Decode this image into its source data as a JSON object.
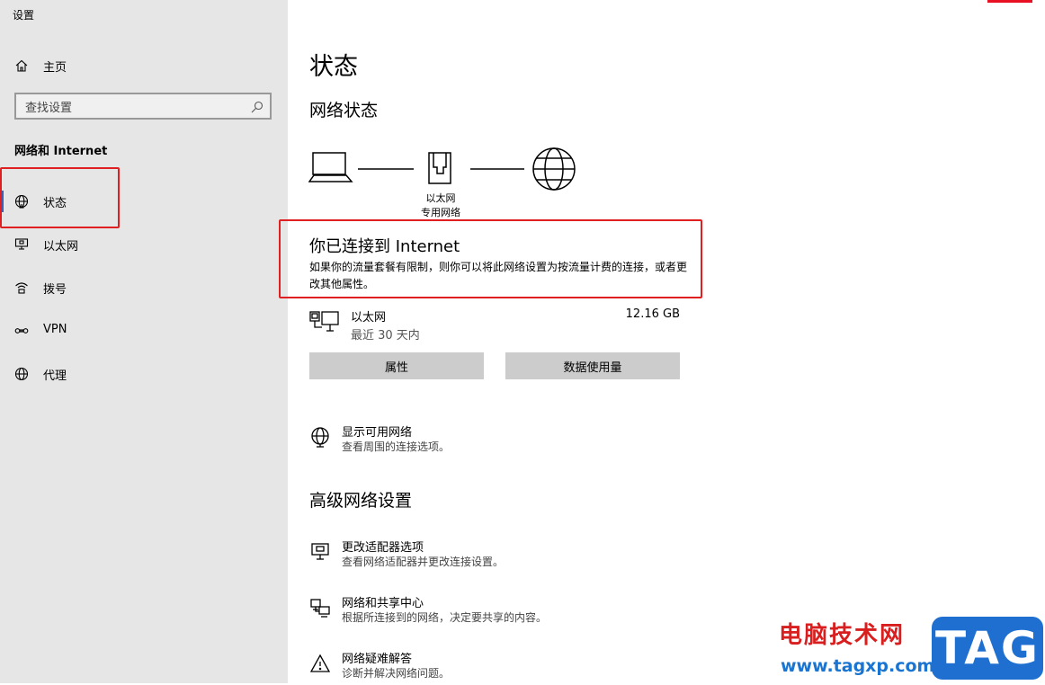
{
  "window": {
    "title": "设置"
  },
  "sidebar": {
    "home_label": "主页",
    "search_placeholder": "查找设置",
    "section_title": "网络和 Internet",
    "items": [
      {
        "label": "状态",
        "icon": "globe-status-icon",
        "active": true
      },
      {
        "label": "以太网",
        "icon": "ethernet-icon",
        "active": false
      },
      {
        "label": "拨号",
        "icon": "dialup-icon",
        "active": false
      },
      {
        "label": "VPN",
        "icon": "vpn-icon",
        "active": false
      },
      {
        "label": "代理",
        "icon": "globe-icon",
        "active": false
      }
    ]
  },
  "main": {
    "page_title": "状态",
    "network_status_heading": "网络状态",
    "diagram": {
      "node_label": "以太网",
      "node_sublabel": "专用网络"
    },
    "connection": {
      "title": "你已连接到 Internet",
      "description": "如果你的流量套餐有限制，则你可以将此网络设置为按流量计费的连接，或者更改其他属性。"
    },
    "ethernet": {
      "name": "以太网",
      "period": "最近 30 天内",
      "usage": "12.16 GB"
    },
    "buttons": {
      "properties": "属性",
      "data_usage": "数据使用量"
    },
    "show_networks": {
      "title": "显示可用网络",
      "subtitle": "查看周围的连接选项。"
    },
    "advanced_heading": "高级网络设置",
    "advanced_items": [
      {
        "title": "更改适配器选项",
        "subtitle": "查看网络适配器并更改连接设置。",
        "icon": "adapter-icon"
      },
      {
        "title": "网络和共享中心",
        "subtitle": "根据所连接到的网络，决定要共享的内容。",
        "icon": "sharing-center-icon"
      },
      {
        "title": "网络疑难解答",
        "subtitle": "诊断并解决网络问题。",
        "icon": "warning-icon"
      }
    ]
  },
  "watermark": {
    "cn_text": "电脑技术网",
    "url": "www.tagxp.com",
    "badge": "TAG"
  },
  "colors": {
    "sidebar_bg": "#e6e6e6",
    "accent": "#3f5fb5",
    "highlight_box": "#e02020",
    "button_bg": "#cccccc"
  }
}
